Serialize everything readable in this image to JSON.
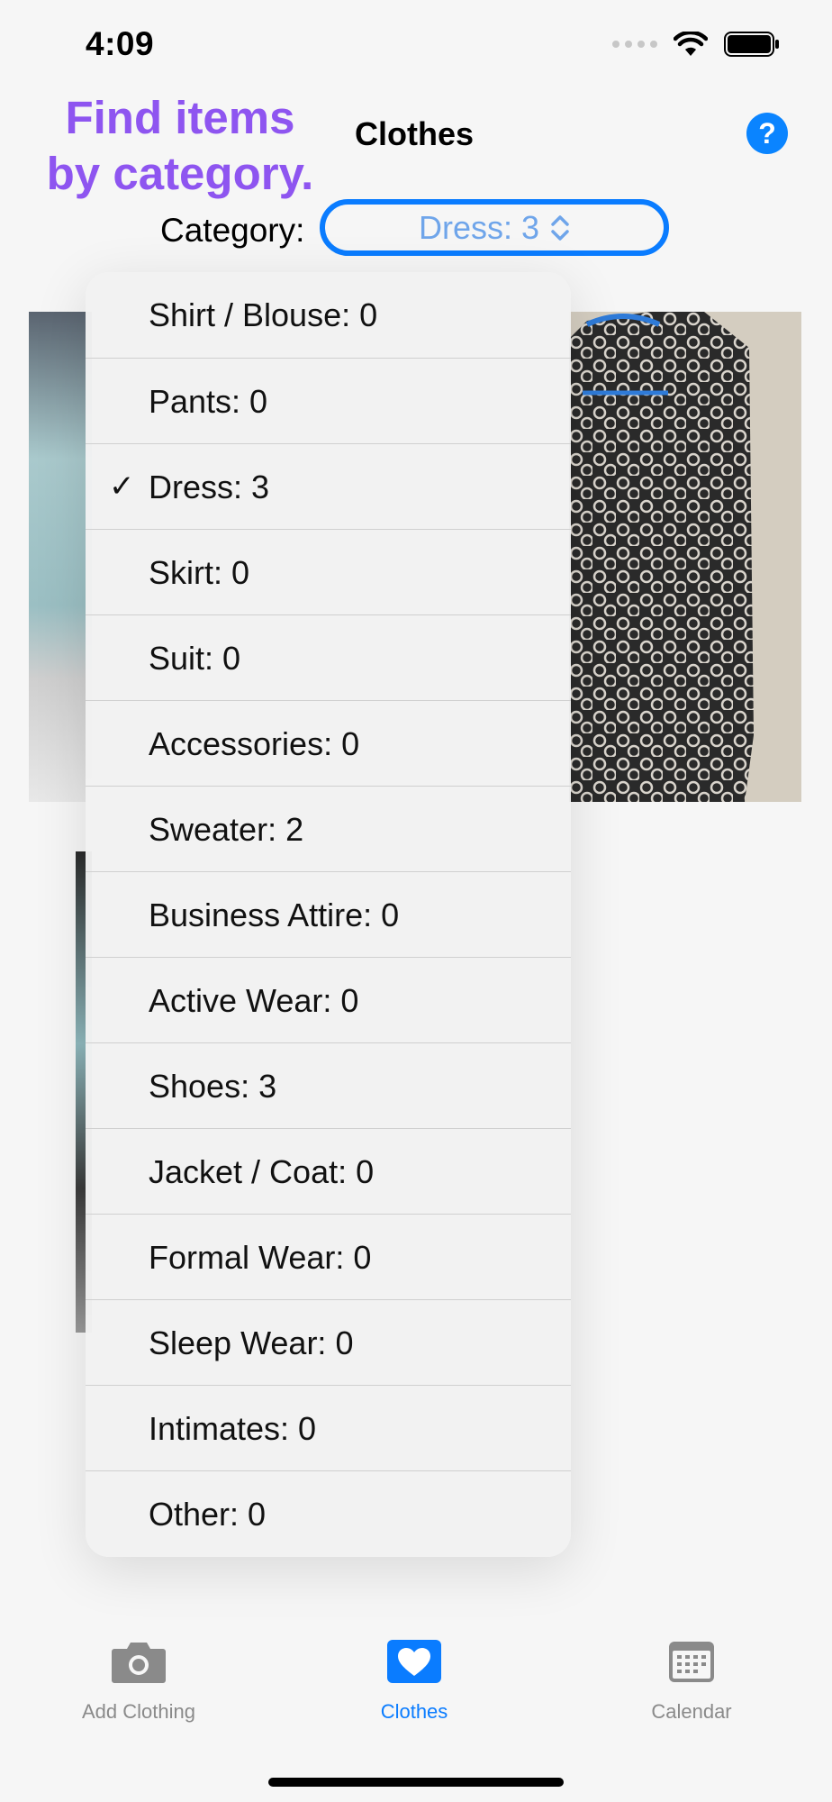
{
  "status_bar": {
    "time": "4:09"
  },
  "header": {
    "hint_line1": "Find items",
    "hint_line2": "by category.",
    "title": "Clothes",
    "help_label": "?"
  },
  "category": {
    "label": "Category:",
    "selected": "Dress: 3"
  },
  "dropdown": {
    "items": [
      {
        "label": "Shirt / Blouse: 0",
        "checked": false
      },
      {
        "label": "Pants: 0",
        "checked": false
      },
      {
        "label": "Dress: 3",
        "checked": true
      },
      {
        "label": "Skirt: 0",
        "checked": false
      },
      {
        "label": "Suit: 0",
        "checked": false
      },
      {
        "label": "Accessories: 0",
        "checked": false
      },
      {
        "label": "Sweater: 2",
        "checked": false
      },
      {
        "label": "Business Attire: 0",
        "checked": false
      },
      {
        "label": "Active Wear: 0",
        "checked": false
      },
      {
        "label": "Shoes: 3",
        "checked": false
      },
      {
        "label": "Jacket / Coat: 0",
        "checked": false
      },
      {
        "label": "Formal Wear: 0",
        "checked": false
      },
      {
        "label": "Sleep Wear: 0",
        "checked": false
      },
      {
        "label": "Intimates: 0",
        "checked": false
      },
      {
        "label": "Other: 0",
        "checked": false
      }
    ],
    "check_glyph": "✓"
  },
  "tab_bar": {
    "tabs": [
      {
        "label": "Add Clothing",
        "icon": "camera-icon",
        "active": false
      },
      {
        "label": "Clothes",
        "icon": "heart-icon",
        "active": true
      },
      {
        "label": "Calendar",
        "icon": "calendar-icon",
        "active": false
      }
    ]
  },
  "colors": {
    "accent": "#0a7cff",
    "hint": "#8e55f0",
    "inactive_tab": "#8a8a8a"
  }
}
